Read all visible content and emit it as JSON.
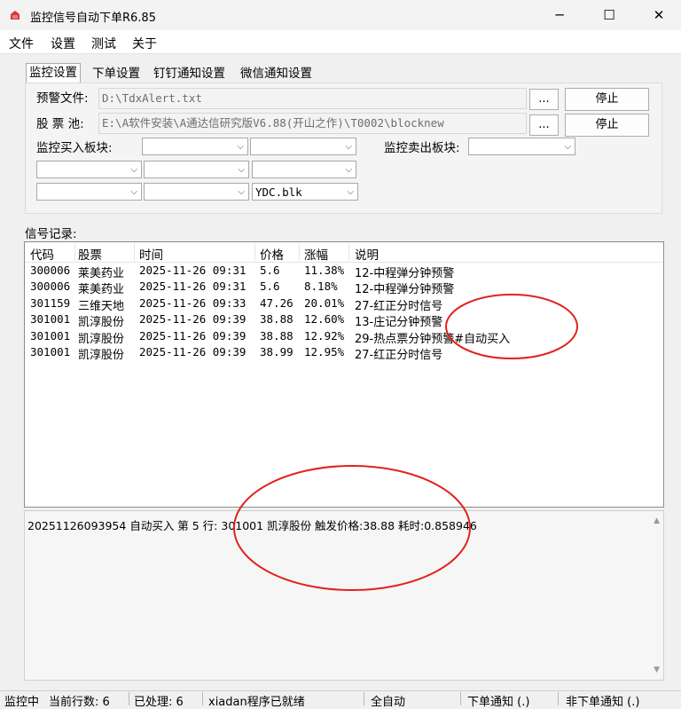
{
  "window": {
    "title": "监控信号自动下单R6.85",
    "minimize_glyph": "─",
    "maximize_glyph": "☐",
    "close_glyph": "✕"
  },
  "menu": [
    "文件",
    "设置",
    "测试",
    "关于"
  ],
  "tabs": [
    "监控设置",
    "下单设置",
    "钉钉通知设置",
    "微信通知设置"
  ],
  "settings": {
    "alert_file_label": "预警文件:",
    "alert_file_value": "D:\\TdxAlert.txt",
    "pool_label": "股 票 池:",
    "pool_value": "E:\\A软件安装\\A通达信研究版V6.88(开山之作)\\T0002\\blocknew",
    "browse_label": "...",
    "stop_label_1": "停止",
    "stop_label_2": "停止",
    "buy_block_label": "监控买入板块:",
    "sell_block_label": "监控卖出板块:",
    "combo_selected": "YDC.blk"
  },
  "signals": {
    "section_label": "信号记录:",
    "columns": [
      "代码",
      "股票",
      "时间",
      "价格",
      "涨幅",
      "说明"
    ],
    "rows": [
      [
        "300006",
        "莱美药业",
        "2025-11-26 09:31",
        "5.6",
        "11.38%",
        "12-中程弹分钟预警"
      ],
      [
        "300006",
        "莱美药业",
        "2025-11-26 09:31",
        "5.6",
        "8.18%",
        "12-中程弹分钟预警"
      ],
      [
        "301159",
        "三维天地",
        "2025-11-26 09:33",
        "47.26",
        "20.01%",
        "27-红正分时信号"
      ],
      [
        "301001",
        "凯淳股份",
        "2025-11-26 09:39",
        "38.88",
        "12.60%",
        "13-庄记分钟预警"
      ],
      [
        "301001",
        "凯淳股份",
        "2025-11-26 09:39",
        "38.88",
        "12.92%",
        "29-热点票分钟预警#自动买入"
      ],
      [
        "301001",
        "凯淳股份",
        "2025-11-26 09:39",
        "38.99",
        "12.95%",
        "27-红正分时信号"
      ]
    ]
  },
  "log": {
    "line": "20251126093954  自动买入 第 5 行: 301001 凯淳股份 触发价格:38.88  耗时:0.858946",
    "scroll_up": "▲",
    "scroll_down": "▼"
  },
  "status": {
    "monitoring": "监控中",
    "current_rows": "当前行数: 6",
    "processed": "已处理: 6",
    "ready": "xiadan程序已就绪",
    "auto": "全自动",
    "order_notify": "下单通知 (.)",
    "non_order_notify": "非下单通知 (.)"
  },
  "colors": {
    "annotation_red": "#e0231c",
    "icon_red": "#d9363e"
  }
}
